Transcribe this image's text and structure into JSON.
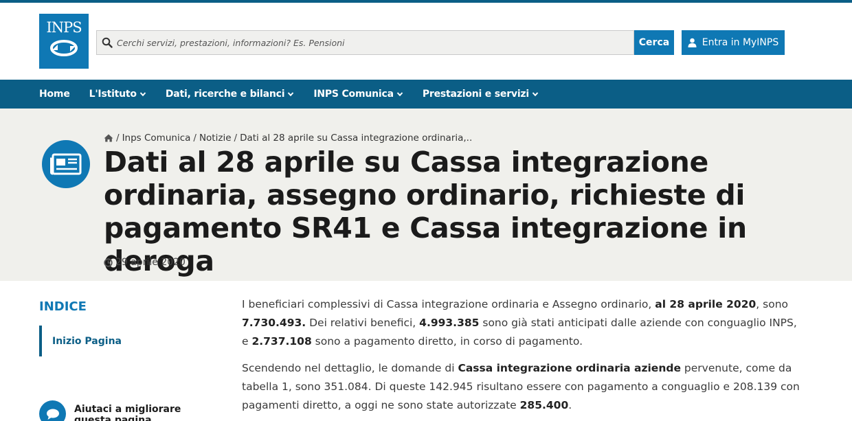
{
  "header": {
    "logo_text": "INPS",
    "search_placeholder": "Cerchi servizi, prestazioni, informazioni? Es. Pensioni",
    "search_button": "Cerca",
    "login_button": "Entra in MyINPS"
  },
  "nav": {
    "items": [
      {
        "label": "Home",
        "dropdown": false
      },
      {
        "label": "L'Istituto",
        "dropdown": true
      },
      {
        "label": "Dati, ricerche e bilanci",
        "dropdown": true
      },
      {
        "label": "INPS Comunica",
        "dropdown": true
      },
      {
        "label": "Prestazioni e servizi",
        "dropdown": true
      }
    ]
  },
  "breadcrumb": {
    "items": [
      "Inps Comunica",
      "Notizie",
      "Dati al 28 aprile su Cassa integrazione ordinaria,.."
    ]
  },
  "page": {
    "title": "Dati al 28 aprile su Cassa integrazione ordinaria, assegno ordinario, richieste di pagamento SR41 e Cassa integrazione in deroga",
    "date": "29 aprile 2020"
  },
  "sidebar": {
    "indice_title": "INDICE",
    "items": [
      {
        "label": "Inizio Pagina"
      }
    ],
    "help_text": "Aiutaci a migliorare questa pagina"
  },
  "article": {
    "p1": {
      "t1": "I beneficiari complessivi di Cassa integrazione ordinaria e Assegno ordinario, ",
      "b1": "al 28 aprile 2020",
      "t2": ", sono ",
      "b2": "7.730.493.",
      "t3": " Dei relativi benefici, ",
      "b3": "4.993.385",
      "t4": " sono già stati anticipati dalle aziende con conguaglio INPS, e ",
      "b4": "2.737.108",
      "t5": " sono a pagamento diretto, in corso di pagamento."
    },
    "p2": {
      "t1": "Scendendo nel dettaglio, le domande di ",
      "b1": "Cassa integrazione ordinaria aziende",
      "t2": " pervenute, come da tabella 1, sono 351.084. Di queste 142.945 risultano essere con pagamento a conguaglio e 208.139 con pagamenti diretto, a oggi ne sono state autorizzate ",
      "b2": "285.400",
      "t3": "."
    }
  },
  "colors": {
    "brand": "#0f78b4",
    "nav_bg": "#0b5e86",
    "hero_bg": "#f0f0ec"
  }
}
